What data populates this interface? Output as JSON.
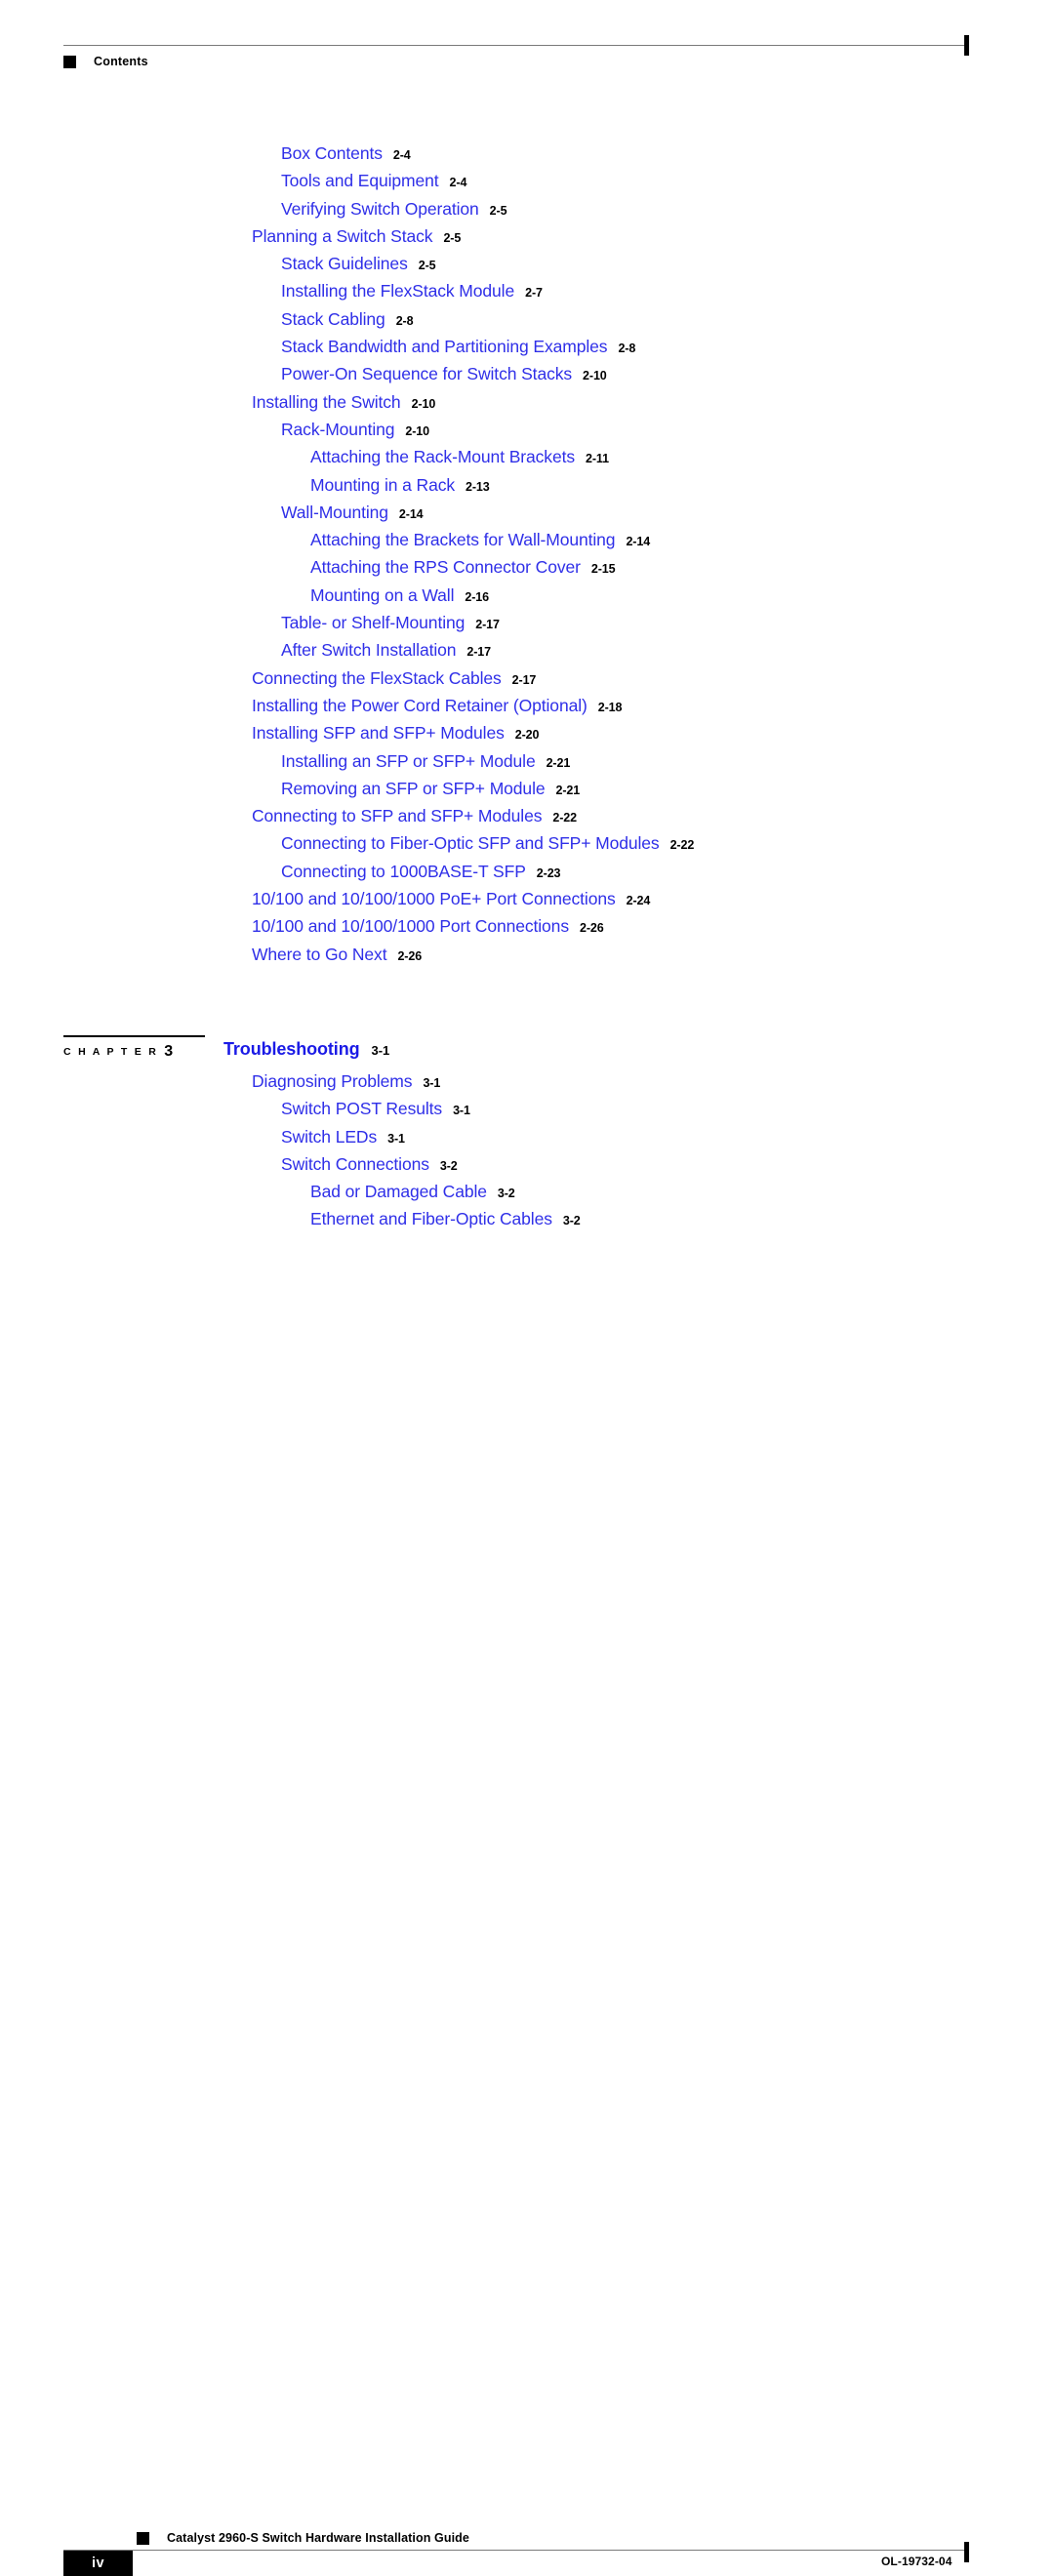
{
  "header": {
    "title": "Contents",
    "bullet_icon": "black-square-icon"
  },
  "chapter": {
    "label": "C H A P T E R",
    "number": "3",
    "title": "Troubleshooting",
    "page": "3-1"
  },
  "footer": {
    "page_number": "iv",
    "guide_title": "Catalyst 2960-S Switch Hardware Installation Guide",
    "doc_id": "OL-19732-04",
    "bullet_icon": "black-square-icon"
  },
  "colors": {
    "link_blue": "#2f2fe8",
    "chapter_blue": "#1a1ae6",
    "rule_gray": "#7a7a7a",
    "black": "#000000"
  },
  "toc_before_chapter": [
    {
      "title": "Box Contents",
      "page": "2-4",
      "level": 2
    },
    {
      "title": "Tools and Equipment",
      "page": "2-4",
      "level": 2
    },
    {
      "title": "Verifying Switch Operation",
      "page": "2-5",
      "level": 2
    },
    {
      "title": "Planning a Switch Stack",
      "page": "2-5",
      "level": 1
    },
    {
      "title": "Stack Guidelines",
      "page": "2-5",
      "level": 2
    },
    {
      "title": "Installing the FlexStack Module",
      "page": "2-7",
      "level": 2
    },
    {
      "title": "Stack Cabling",
      "page": "2-8",
      "level": 2
    },
    {
      "title": "Stack Bandwidth and Partitioning Examples",
      "page": "2-8",
      "level": 2
    },
    {
      "title": "Power-On Sequence for Switch Stacks",
      "page": "2-10",
      "level": 2
    },
    {
      "title": "Installing the Switch",
      "page": "2-10",
      "level": 1
    },
    {
      "title": "Rack-Mounting",
      "page": "2-10",
      "level": 2
    },
    {
      "title": "Attaching the Rack-Mount Brackets",
      "page": "2-11",
      "level": 3
    },
    {
      "title": "Mounting in a Rack",
      "page": "2-13",
      "level": 3
    },
    {
      "title": "Wall-Mounting",
      "page": "2-14",
      "level": 2
    },
    {
      "title": "Attaching the Brackets for Wall-Mounting",
      "page": "2-14",
      "level": 3
    },
    {
      "title": "Attaching the RPS Connector Cover",
      "page": "2-15",
      "level": 3
    },
    {
      "title": "Mounting on a Wall",
      "page": "2-16",
      "level": 3
    },
    {
      "title": "Table- or Shelf-Mounting",
      "page": "2-17",
      "level": 2
    },
    {
      "title": "After Switch Installation",
      "page": "2-17",
      "level": 2
    },
    {
      "title": "Connecting the FlexStack Cables",
      "page": "2-17",
      "level": 1
    },
    {
      "title": "Installing the Power Cord Retainer (Optional)",
      "page": "2-18",
      "level": 1
    },
    {
      "title": "Installing SFP and SFP+ Modules",
      "page": "2-20",
      "level": 1
    },
    {
      "title": "Installing an SFP or SFP+ Module",
      "page": "2-21",
      "level": 2
    },
    {
      "title": "Removing an SFP or SFP+ Module",
      "page": "2-21",
      "level": 2
    },
    {
      "title": "Connecting to SFP and SFP+ Modules",
      "page": "2-22",
      "level": 1
    },
    {
      "title": "Connecting to Fiber-Optic SFP and SFP+ Modules",
      "page": "2-22",
      "level": 2
    },
    {
      "title": "Connecting to 1000BASE-T SFP",
      "page": "2-23",
      "level": 2
    },
    {
      "title": "10/100 and 10/100/1000 PoE+ Port Connections",
      "page": "2-24",
      "level": 1
    },
    {
      "title": "10/100 and 10/100/1000 Port Connections",
      "page": "2-26",
      "level": 1
    },
    {
      "title": "Where to Go Next",
      "page": "2-26",
      "level": 1
    }
  ],
  "toc_after_chapter": [
    {
      "title": "Diagnosing Problems",
      "page": "3-1",
      "level": 1
    },
    {
      "title": "Switch POST Results",
      "page": "3-1",
      "level": 2
    },
    {
      "title": "Switch LEDs",
      "page": "3-1",
      "level": 2
    },
    {
      "title": "Switch Connections",
      "page": "3-2",
      "level": 2
    },
    {
      "title": "Bad or Damaged Cable",
      "page": "3-2",
      "level": 3
    },
    {
      "title": "Ethernet and Fiber-Optic Cables",
      "page": "3-2",
      "level": 3
    }
  ]
}
